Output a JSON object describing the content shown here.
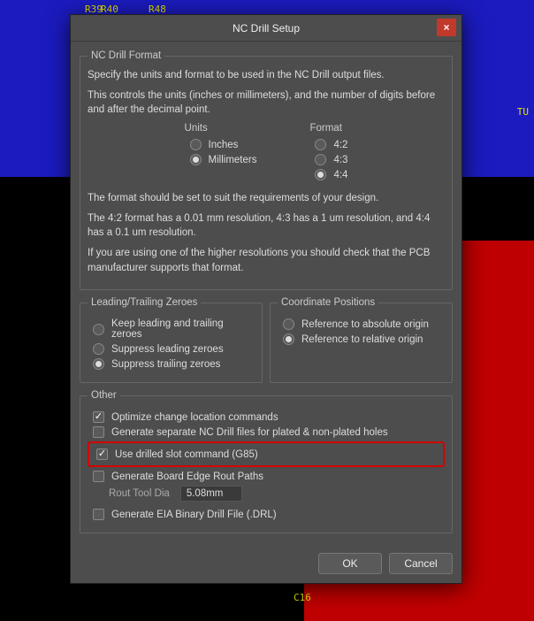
{
  "bg": {
    "d1": "R40",
    "d2": "R48",
    "d3": "R39",
    "d4": "C16",
    "d5": "TU"
  },
  "dialog": {
    "title": "NC Drill Setup",
    "close": "×",
    "format": {
      "legend": "NC Drill Format",
      "line1": "Specify the units and format to be used in the NC Drill output files.",
      "line2": "This controls the units (inches or millimeters), and the number of digits before and after the decimal point.",
      "units": {
        "title": "Units",
        "inches": "Inches",
        "millimeters": "Millimeters"
      },
      "fmt": {
        "title": "Format",
        "f42": "4:2",
        "f43": "4:3",
        "f44": "4:4"
      },
      "line3": "The format should be set to suit the requirements of your design.",
      "line4": "The 4:2 format has a 0.01 mm resolution, 4:3 has a 1 um resolution, and 4:4 has a 0.1 um resolution.",
      "line5": "If you are using one of the higher resolutions you should check that the PCB manufacturer supports that format."
    },
    "zeroes": {
      "legend": "Leading/Trailing Zeroes",
      "keep": "Keep leading and trailing zeroes",
      "supL": "Suppress leading zeroes",
      "supT": "Suppress trailing zeroes"
    },
    "coord": {
      "legend": "Coordinate Positions",
      "abs": "Reference to absolute origin",
      "rel": "Reference to relative origin"
    },
    "other": {
      "legend": "Other",
      "optimize": "Optimize change location commands",
      "separate": "Generate separate NC Drill files for plated & non-plated holes",
      "slot": "Use drilled slot command (G85)",
      "rout": "Generate Board Edge Rout Paths",
      "routToolLabel": "Rout Tool Dia",
      "routToolValue": "5.08mm",
      "eia": "Generate EIA Binary Drill File (.DRL)"
    },
    "buttons": {
      "ok": "OK",
      "cancel": "Cancel"
    }
  }
}
